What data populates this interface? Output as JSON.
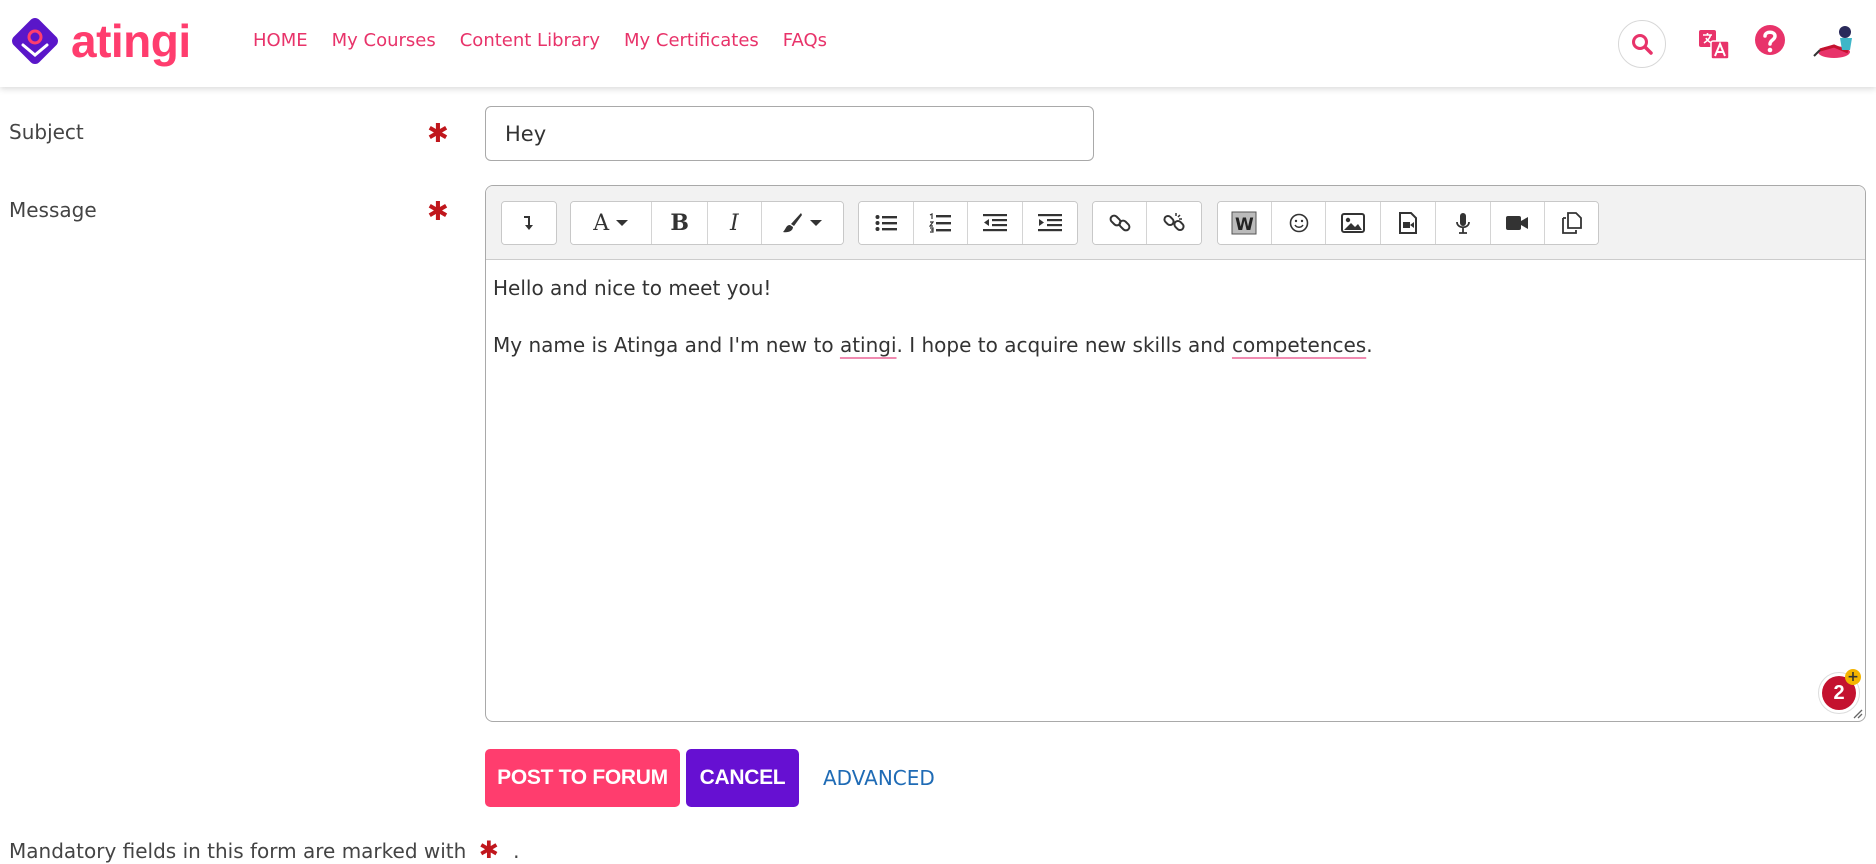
{
  "brand": {
    "name": "atingi",
    "accent": "#ff3d6e",
    "logo_fill": "#5a16c9"
  },
  "nav": {
    "links": [
      {
        "label": "HOME"
      },
      {
        "label": "My Courses"
      },
      {
        "label": "Content Library"
      },
      {
        "label": "My Certificates"
      },
      {
        "label": "FAQs"
      }
    ],
    "icons": [
      "search-icon",
      "translate-icon",
      "help-icon",
      "avatar"
    ]
  },
  "form": {
    "subject": {
      "label": "Subject",
      "value": "Hey"
    },
    "message": {
      "label": "Message",
      "lines": [
        "Hello and nice to meet you!",
        {
          "before": "My name is Atinga and I'm new to ",
          "spell1": "atingi",
          "middle": ". I hope to acquire new skills and ",
          "spell2": "competences",
          "after": "."
        }
      ]
    },
    "required_symbol": "✱",
    "notification_count": "2",
    "notification_plus": "+"
  },
  "toolbar": {
    "buttons": [
      "toggle-toolbar-icon",
      "font-style-icon",
      "bold-icon",
      "italic-icon",
      "color-icon",
      "unordered-list-icon",
      "ordered-list-icon",
      "outdent-icon",
      "indent-icon",
      "link-icon",
      "unlink-icon",
      "word-paste-icon",
      "emoji-icon",
      "image-icon",
      "media-icon",
      "record-audio-icon",
      "record-video-icon",
      "manage-files-icon"
    ]
  },
  "actions": {
    "post_label": "POST TO FORUM",
    "cancel_label": "CANCEL",
    "advanced_label": "ADVANCED"
  },
  "footnote": {
    "text": "Mandatory fields in this form are marked with",
    "period": "."
  },
  "colors": {
    "required": "#c0161c",
    "post_button": "#ff3d6e",
    "cancel_button": "#6610d2",
    "link": "#1f6bb5"
  }
}
